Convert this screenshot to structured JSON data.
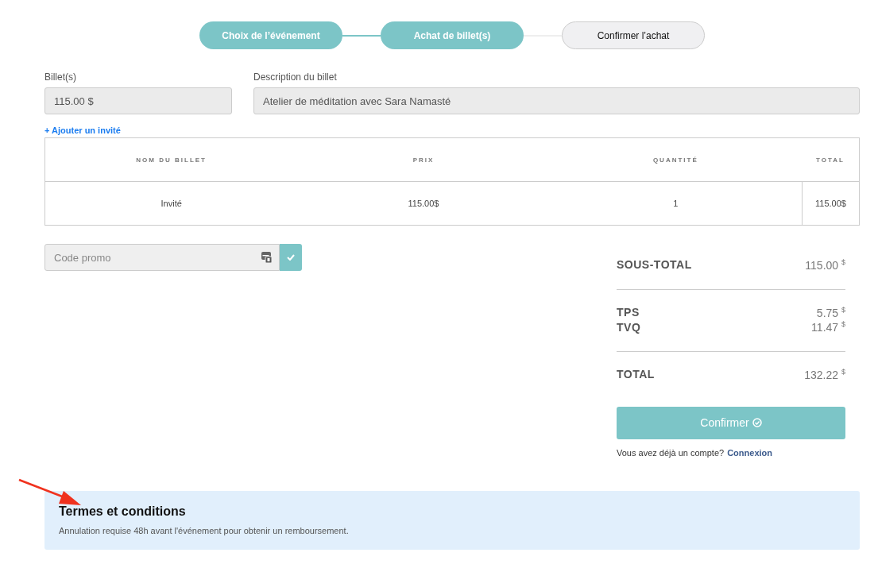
{
  "steps": [
    {
      "label": "Choix de l’événement",
      "completed": true
    },
    {
      "label": "Achat de billet(s)",
      "completed": true
    },
    {
      "label": "Confirmer l’achat",
      "completed": false
    }
  ],
  "fields": [
    {
      "label": "Billet(s)",
      "value": "115.00 $"
    },
    {
      "label": "Description du billet",
      "value": "Atelier de méditation avec Sara Namasté"
    }
  ],
  "add_guest_link": "+ Ajouter un invité",
  "table": {
    "columns": [
      "NOM DU BILLET",
      "PRIX",
      "QUANTITÉ",
      "TOTAL"
    ],
    "rows": [
      [
        "Invité",
        "115.00$",
        "1",
        "115.00$"
      ]
    ]
  },
  "promo": {
    "placeholder": "Code promo"
  },
  "summary": {
    "groups": [
      [
        {
          "label": "SOUS-TOTAL",
          "amount": "115.00",
          "currency": "$"
        }
      ],
      [
        {
          "label": "TPS",
          "amount": "5.75",
          "currency": "$"
        },
        {
          "label": "TVQ",
          "amount": "11.47",
          "currency": "$"
        }
      ],
      [
        {
          "label": "TOTAL",
          "amount": "132.22",
          "currency": "$"
        }
      ]
    ]
  },
  "confirm_button": "Confirmer",
  "account_prompt": "Vous avez déjà un compte?",
  "login_link": "Connexion",
  "terms": {
    "title": "Termes et conditions",
    "text": "Annulation requise 48h avant l'événement pour obtenir un remboursement."
  }
}
